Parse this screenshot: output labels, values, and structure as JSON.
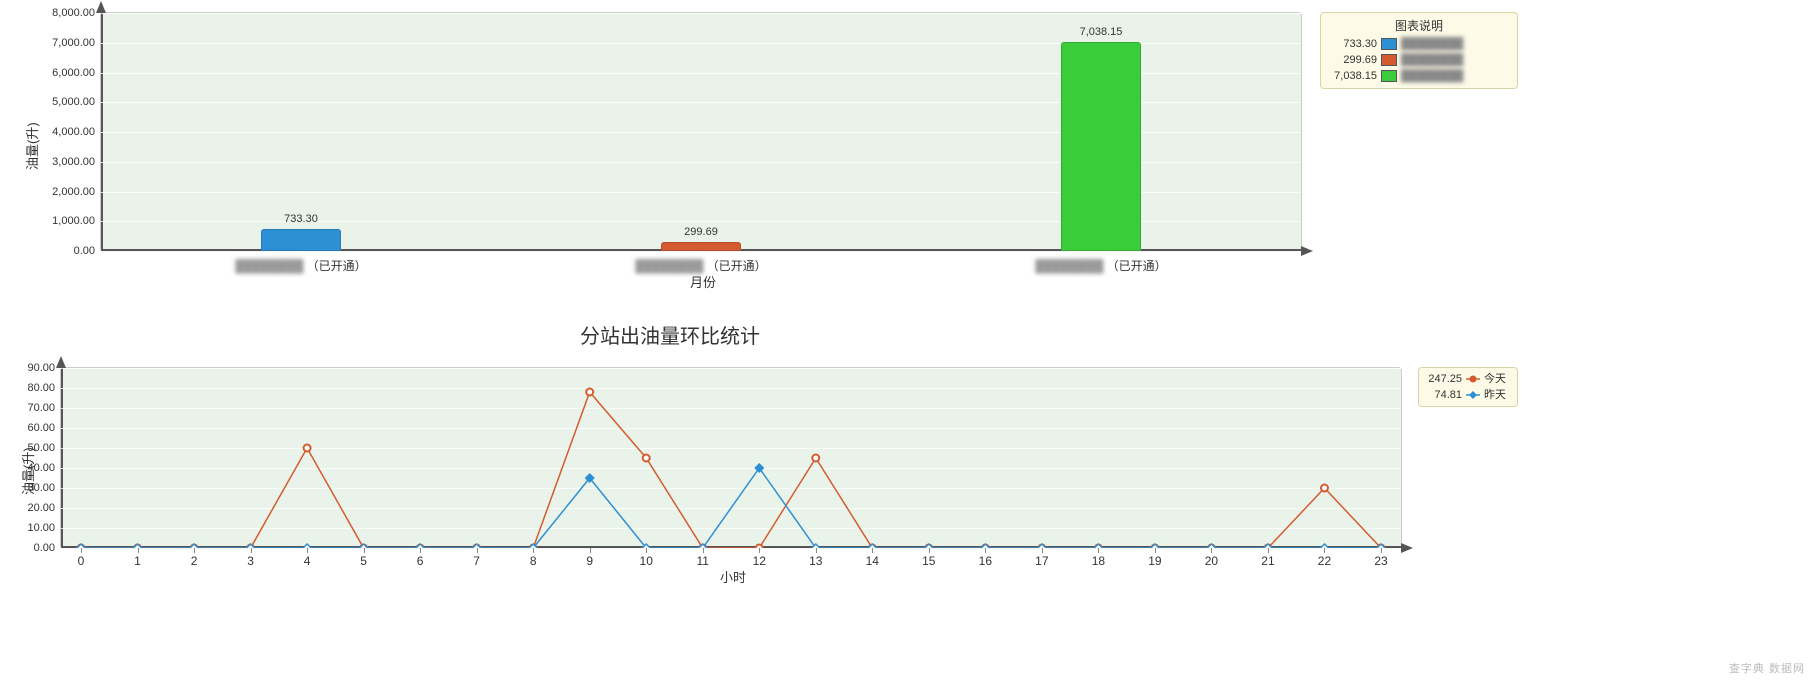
{
  "chart_data": [
    {
      "type": "bar",
      "title": "",
      "xlabel": "月份",
      "ylabel": "油量(升)",
      "ylim": [
        0,
        8000
      ],
      "y_ticks": [
        "0.00",
        "1,000.00",
        "2,000.00",
        "3,000.00",
        "4,000.00",
        "5,000.00",
        "6,000.00",
        "7,000.00",
        "8,000.00"
      ],
      "categories": [
        "（已开通）",
        "（已开通）",
        "（已开通）"
      ],
      "category_blurred_prefix": [
        "████████",
        "████████",
        "████████"
      ],
      "series": [
        {
          "name": "733.30",
          "color": "#2d8fd4",
          "values": [
            733.3,
            null,
            null
          ]
        },
        {
          "name": "299.69",
          "color": "#d45b2f",
          "values": [
            null,
            299.69,
            null
          ]
        },
        {
          "name": "7,038.15",
          "color": "#3bcc3b",
          "values": [
            null,
            null,
            7038.15
          ]
        }
      ],
      "legend_title": "图表说明",
      "legend_rows": [
        {
          "value": "733.30",
          "color": "#2d8fd4"
        },
        {
          "value": "299.69",
          "color": "#d45b2f"
        },
        {
          "value": "7,038.15",
          "color": "#3bcc3b"
        }
      ]
    },
    {
      "type": "line",
      "title": "分站出油量环比统计",
      "xlabel": "小时",
      "ylabel": "油量(升)",
      "ylim": [
        0,
        90
      ],
      "y_ticks": [
        "0.00",
        "10.00",
        "20.00",
        "30.00",
        "40.00",
        "50.00",
        "60.00",
        "70.00",
        "80.00",
        "90.00"
      ],
      "x": [
        0,
        1,
        2,
        3,
        4,
        5,
        6,
        7,
        8,
        9,
        10,
        11,
        12,
        13,
        14,
        15,
        16,
        17,
        18,
        19,
        20,
        21,
        22,
        23
      ],
      "series": [
        {
          "name": "今天",
          "total": "247.25",
          "color": "#d45b2f",
          "marker": "circle",
          "values": [
            0,
            0,
            0,
            0,
            50,
            0,
            0,
            0,
            0,
            78,
            45,
            0,
            0,
            45,
            0,
            0,
            0,
            0,
            0,
            0,
            0,
            0,
            30,
            0
          ]
        },
        {
          "name": "昨天",
          "total": "74.81",
          "color": "#2d8fd4",
          "marker": "star",
          "values": [
            0,
            0,
            0,
            0,
            0,
            0,
            0,
            0,
            0,
            35,
            0,
            0,
            40,
            0,
            0,
            0,
            0,
            0,
            0,
            0,
            0,
            0,
            0,
            0
          ]
        }
      ],
      "legend_rows": [
        {
          "value": "247.25",
          "color": "#d45b2f",
          "label": "今天",
          "marker": "circle"
        },
        {
          "value": "74.81",
          "color": "#2d8fd4",
          "label": "昨天",
          "marker": "star"
        }
      ]
    }
  ],
  "watermark": "查字典 数据网"
}
